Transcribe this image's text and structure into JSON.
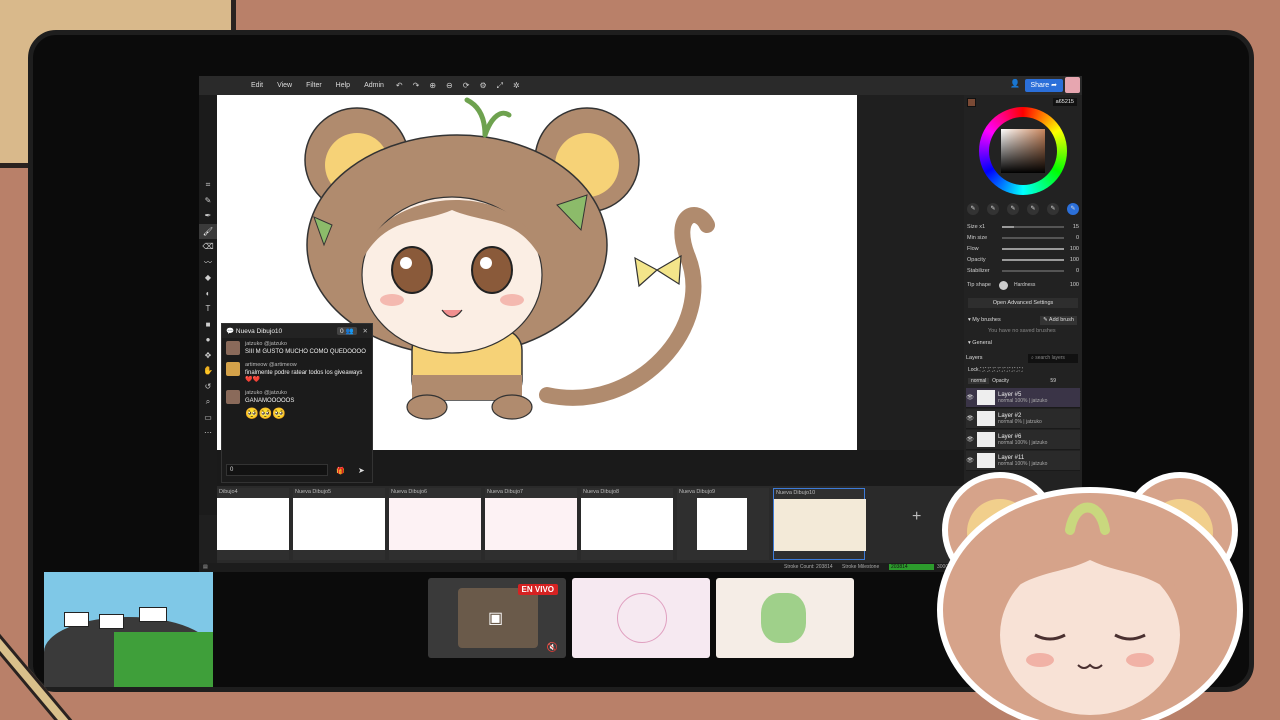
{
  "menu": {
    "items": [
      "Edit",
      "View",
      "Filter",
      "Help",
      "Admin"
    ],
    "share_label": "Share"
  },
  "color": {
    "hex": "a65215"
  },
  "chat": {
    "title": "Nueva Dibujo10",
    "count": "0",
    "messages": [
      {
        "user": "jatzuko @jatzuko",
        "text": "SIII M GUSTO MUCHO COMO QUEDOOOO"
      },
      {
        "user": "artimeow @artimeow",
        "text": "finalmente podre ratear todos los giveaways ❤️❤️"
      },
      {
        "user": "jatzuko @jatzuko",
        "text": "GANAMOOOOOS"
      }
    ],
    "emojis": "🥺🥺🥺",
    "input_value": "0"
  },
  "panel": {
    "props": [
      {
        "label": "Size x1",
        "value": "15"
      },
      {
        "label": "Min size",
        "value": "0"
      },
      {
        "label": "Flow",
        "value": "100"
      },
      {
        "label": "Opacity",
        "value": "100"
      },
      {
        "label": "Stabilizer",
        "value": "0"
      }
    ],
    "tip_shape": "Tip shape",
    "hardness_label": "Hardness",
    "hardness_value": "100",
    "open_advanced": "Open Advanced Settings",
    "my_brushes": "My brushes",
    "add_brush": "Add brush",
    "no_saved": "You have no saved brushes",
    "general": "General",
    "layers_title": "Layers",
    "layers_search": "search layers",
    "lock_label": "Lock",
    "blend_mode": "normal",
    "opacity_label": "Opacity",
    "opacity_value": "59",
    "layers": [
      {
        "name": "Layer #5",
        "sub": "normal 100% | jatzuko"
      },
      {
        "name": "Layer #2",
        "sub": "normal 0% | jatzuko"
      },
      {
        "name": "Layer #6",
        "sub": "normal 100% | jatzuko"
      },
      {
        "name": "Layer #11",
        "sub": "normal 100% | jatzuko"
      }
    ]
  },
  "drawings": [
    "Dibujo4",
    "Nueva Dibujo5",
    "Nueva Dibujo6",
    "Nueva Dibujo7",
    "Nueva Dibujo8",
    "Nueva Dibujo9",
    "Nueva Dibujo10"
  ],
  "status": {
    "stroke_count": "Stroke Count: 203814",
    "stroke_milestone": "Stroke Milestone",
    "milestone_value": "203814",
    "milestone_total": "3000"
  },
  "live_badge": "EN VIVO"
}
